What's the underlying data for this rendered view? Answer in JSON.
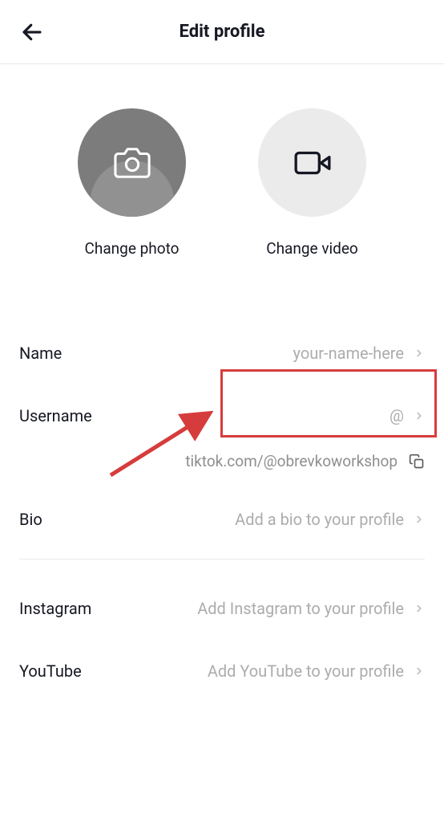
{
  "header": {
    "title": "Edit profile"
  },
  "media": {
    "photo_label": "Change photo",
    "video_label": "Change video"
  },
  "rows": {
    "name": {
      "label": "Name",
      "value": "your-name-here"
    },
    "username": {
      "label": "Username",
      "value": "@"
    },
    "url": {
      "text": "tiktok.com/@obrevkoworkshop"
    },
    "bio": {
      "label": "Bio",
      "placeholder": "Add a bio to your profile"
    },
    "instagram": {
      "label": "Instagram",
      "placeholder": "Add Instagram to your profile"
    },
    "youtube": {
      "label": "YouTube",
      "placeholder": "Add YouTube to your profile"
    }
  }
}
